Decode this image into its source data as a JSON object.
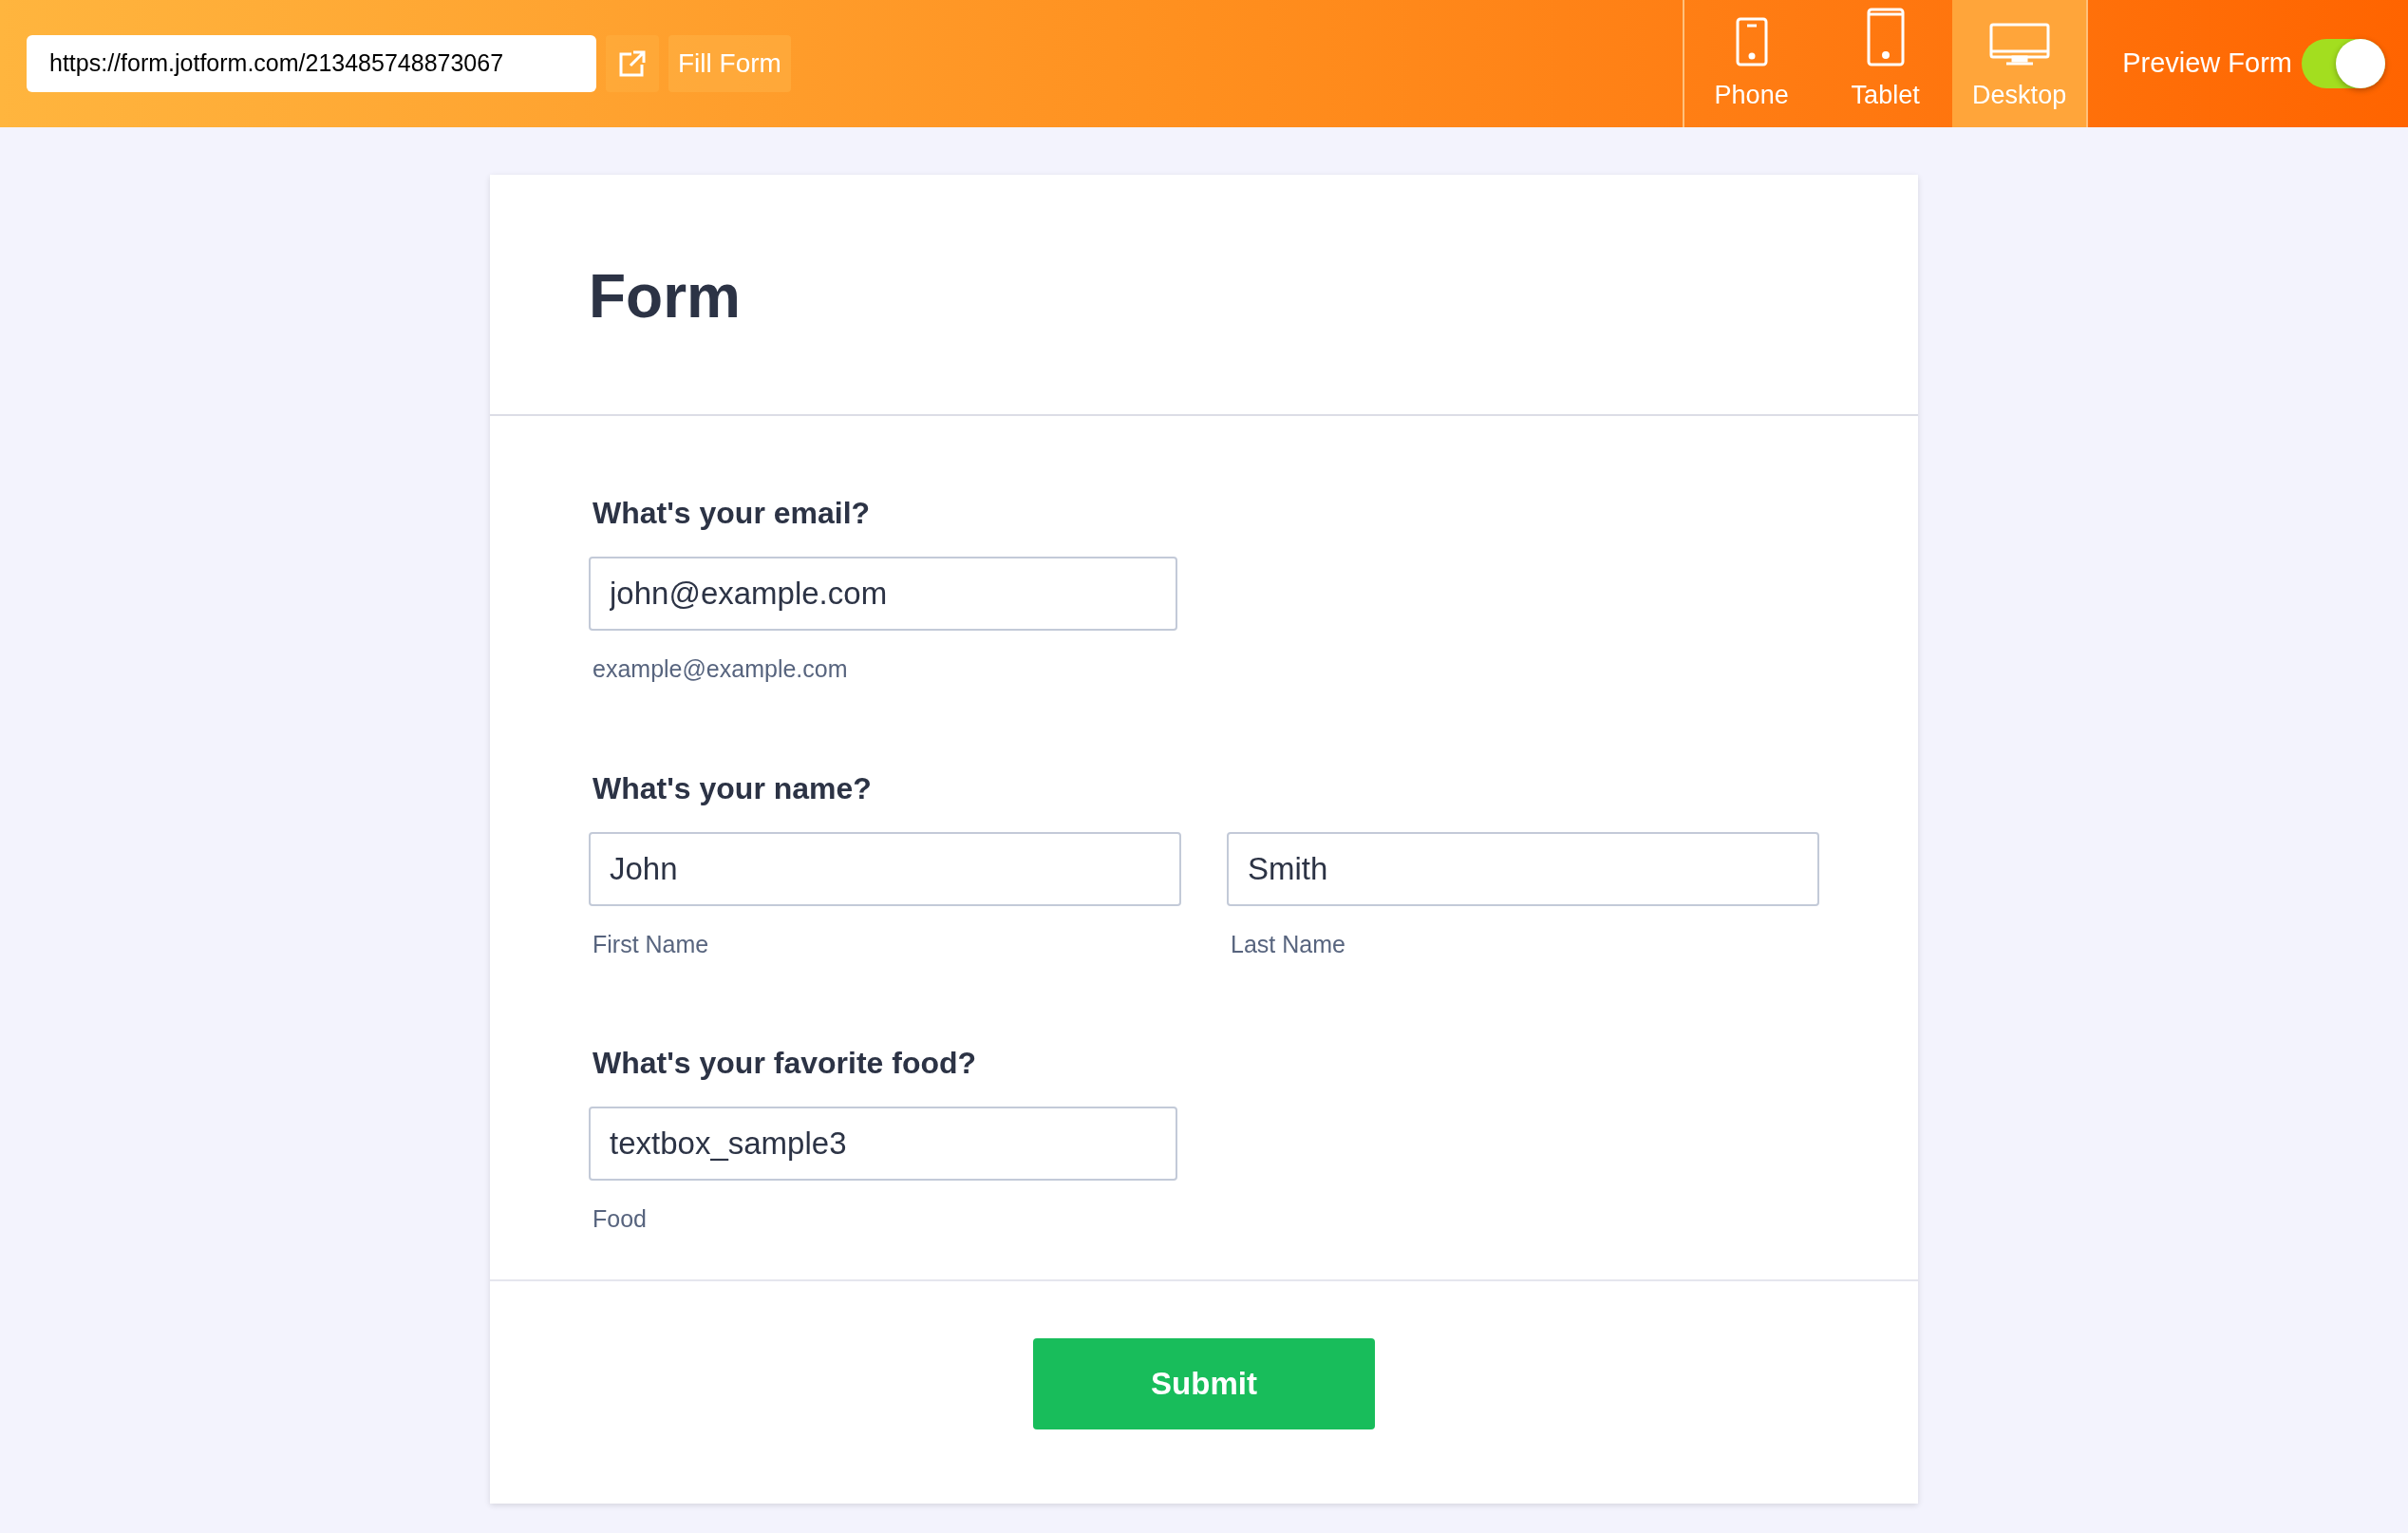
{
  "toolbar": {
    "url": "https://form.jotform.com/213485748873067",
    "fill_button": "Fill Form",
    "devices": [
      {
        "label": "Phone",
        "kind": "phone",
        "selected": false
      },
      {
        "label": "Tablet",
        "kind": "tablet",
        "selected": false
      },
      {
        "label": "Desktop",
        "kind": "desktop",
        "selected": true
      }
    ],
    "preview": {
      "label": "Preview Form",
      "on": true
    }
  },
  "form": {
    "title": "Form",
    "questions": [
      {
        "label": "What's your email?",
        "fields": [
          {
            "value": "john@example.com",
            "sublabel": "example@example.com"
          }
        ]
      },
      {
        "label": "What's your name?",
        "fields": [
          {
            "value": "John",
            "sublabel": "First Name"
          },
          {
            "value": "Smith",
            "sublabel": "Last Name"
          }
        ]
      },
      {
        "label": "What's your favorite food?",
        "fields": [
          {
            "value": "textbox_sample3",
            "sublabel": "Food"
          }
        ]
      }
    ],
    "submit": "Submit"
  }
}
